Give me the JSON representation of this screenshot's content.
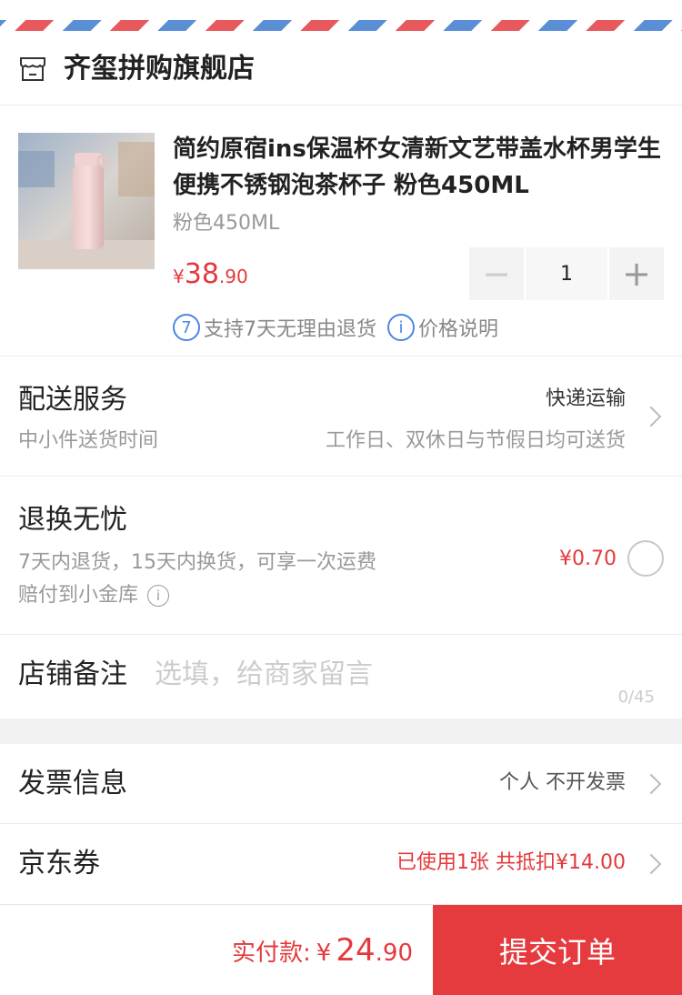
{
  "shop": {
    "name": "齐玺拼购旗舰店",
    "icon": "store-icon"
  },
  "product": {
    "title": "简约原宿ins保温杯女清新文艺带盖水杯男学生便携不锈钢泡茶杯子 粉色450ML",
    "spec": "粉色450ML",
    "price_symbol": "¥",
    "price_int": "38",
    "price_dec": ".90",
    "quantity": "1",
    "minus": "−",
    "plus": "+",
    "policy_icon_1": "7",
    "policy_1": "支持7天无理由退货",
    "policy_icon_2": "i",
    "policy_2": "价格说明"
  },
  "delivery": {
    "title": "配送服务",
    "method": "快递运输",
    "sub_left": "中小件送货时间",
    "sub_right": "工作日、双休日与节假日均可送货"
  },
  "returns": {
    "title": "退换无忧",
    "desc_line1": "7天内退货，15天内换货，可享一次运费",
    "desc_line2": "赔付到小金库",
    "info_icon": "i",
    "fee": "¥0.70"
  },
  "note": {
    "label": "店铺备注",
    "placeholder": "选填，给商家留言",
    "counter": "0/45"
  },
  "invoice": {
    "label": "发票信息",
    "value": "个人 不开发票"
  },
  "coupon": {
    "label": "京东券",
    "value": "已使用1张 共抵扣¥14.00"
  },
  "footer": {
    "pay_label": "实付款:",
    "symbol": "¥",
    "amount_int": "24",
    "amount_dec": ".90",
    "submit": "提交订单"
  },
  "colors": {
    "accent": "#e63b3e",
    "price": "#e4393c",
    "info_blue": "#4a87e2"
  }
}
